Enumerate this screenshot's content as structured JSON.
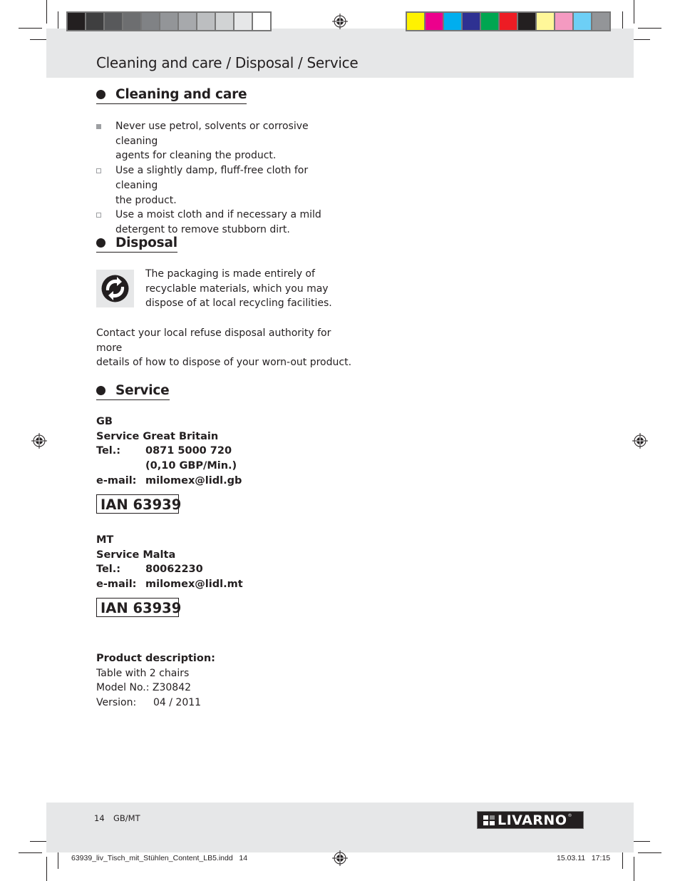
{
  "header": {
    "title": "Cleaning and care / Disposal / Service",
    "grayscale_bar": [
      "#231f20",
      "#3f3f40",
      "#58595b",
      "#6d6e70",
      "#808285",
      "#939598",
      "#a7a9ac",
      "#bcbec0",
      "#d1d3d4",
      "#e6e7e8",
      "#ffffff"
    ],
    "color_bar": [
      "#fff200",
      "#ec008c",
      "#00aeef",
      "#2e3192",
      "#00a651",
      "#ed1c24",
      "#231f20",
      "#fff799",
      "#f49ac1",
      "#6dcff6",
      "#939598"
    ]
  },
  "cleaning": {
    "heading": "Cleaning and care",
    "items": [
      {
        "marker": "filled-square",
        "lines": [
          "Never use petrol, solvents or corrosive cleaning",
          "agents for cleaning the product."
        ]
      },
      {
        "marker": "empty-square",
        "lines": [
          "Use a slightly damp, fluff-free cloth for cleaning",
          "the product."
        ]
      },
      {
        "marker": "empty-square",
        "lines": [
          "Use a moist cloth and if necessary a mild",
          "detergent to remove stubborn dirt."
        ]
      }
    ]
  },
  "disposal": {
    "heading": "Disposal",
    "icon": "recycle-green-dot-icon",
    "packaging_lines": [
      "The packaging is made entirely of",
      "recyclable materials, which you may",
      "dispose of at local recycling facilities."
    ],
    "contact_lines": [
      "Contact your local refuse disposal authority for more",
      "details of how to dispose of your worn-out product."
    ]
  },
  "service": {
    "heading": "Service",
    "gb": {
      "country": "GB",
      "name": "Service Great Britain",
      "tel_label": "Tel.:",
      "tel": "0871 5000 720",
      "tel_rate": "(0,10 GBP/Min.)",
      "email_label": "e-mail:",
      "email": "milomex@lidl.gb",
      "ian": "IAN 63939"
    },
    "mt": {
      "country": "MT",
      "name": "Service Malta",
      "tel_label": "Tel.:",
      "tel": "80062230",
      "email_label": "e-mail:",
      "email": "milomex@lidl.mt",
      "ian": "IAN 63939"
    }
  },
  "product": {
    "heading": "Product description:",
    "name": "Table with 2 chairs",
    "model": "Model No.: Z30842",
    "version_label": "Version:",
    "version": "04 / 2011"
  },
  "footer": {
    "page_number": "14",
    "locale": "GB/MT",
    "brand": "LIVARNO",
    "slug_file": "63939_liv_Tisch_mit_Stühlen_Content_LB5.indd   14",
    "slug_date": "15.03.11   17:15"
  }
}
